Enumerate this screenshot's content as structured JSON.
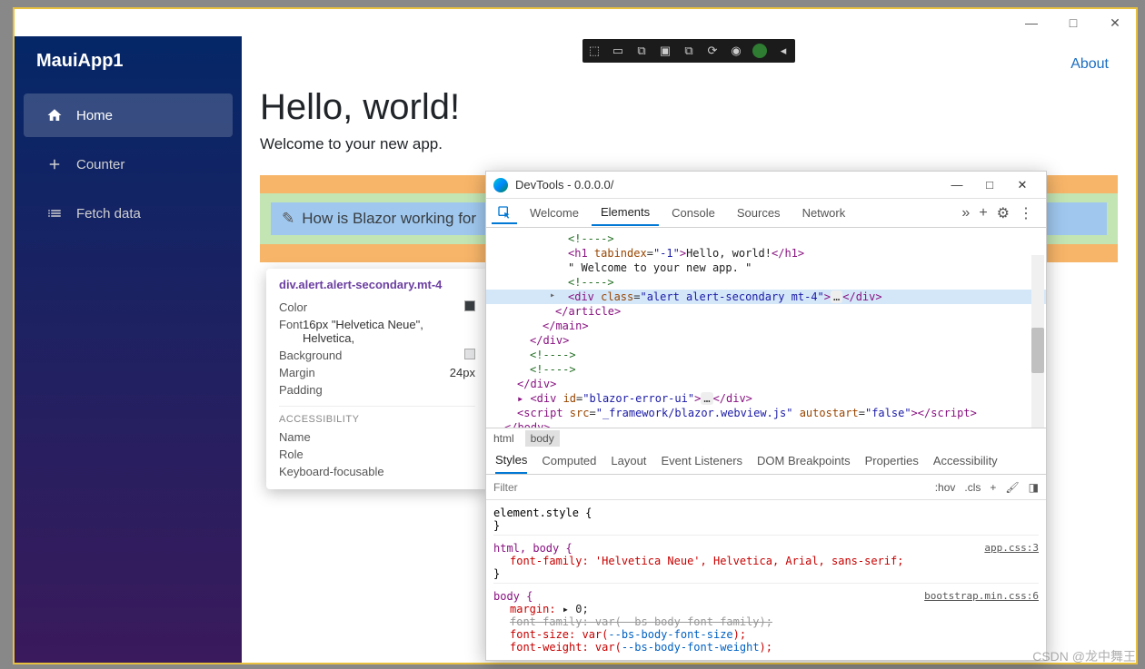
{
  "window": {
    "minimize": "—",
    "maximize": "□",
    "close": "✕"
  },
  "sidebar": {
    "title": "MauiApp1",
    "items": [
      {
        "icon": "home",
        "label": "Home",
        "active": true
      },
      {
        "icon": "plus",
        "label": "Counter",
        "active": false
      },
      {
        "icon": "list",
        "label": "Fetch data",
        "active": false
      }
    ]
  },
  "header": {
    "about": "About"
  },
  "hero": {
    "title": "Hello, world!",
    "subtitle": "Welcome to your new app."
  },
  "highlight": {
    "text": "How is Blazor working for"
  },
  "tooltip": {
    "selector": "div.alert.alert-secondary.mt-4",
    "rows": {
      "color_label": "Color",
      "font_label": "Font",
      "font_value": "16px \"Helvetica Neue\", Helvetica, ",
      "bg_label": "Background",
      "margin_label": "Margin",
      "margin_value": "24px",
      "padding_label": "Padding"
    },
    "a11y_title": "ACCESSIBILITY",
    "a11y": {
      "name": "Name",
      "role": "Role",
      "kbf": "Keyboard-focusable"
    }
  },
  "devtools": {
    "title": "DevTools - 0.0.0.0/",
    "win": {
      "min": "—",
      "max": "□",
      "close": "✕"
    },
    "tabs": {
      "welcome": "Welcome",
      "elements": "Elements",
      "console": "Console",
      "sources": "Sources",
      "network": "Network",
      "more": "»",
      "plus": "+"
    },
    "dom": {
      "l1": "<!---->",
      "l2_open": "<h1 ",
      "l2_attr": "tabindex",
      "l2_val": "\"-1\"",
      "l2_text": "Hello, world!",
      "l2_close": "</h1>",
      "l3": "\" Welcome to your new app. \"",
      "l4": "<!---->",
      "l5_open": "<div ",
      "l5_attr": "class",
      "l5_val": "\"alert alert-secondary mt-4\"",
      "l5_ell": "…",
      "l5_close": "</div>",
      "l6": "</article>",
      "l7": "</main>",
      "l8": "</div>",
      "l9": "<!---->",
      "l10": "<!---->",
      "l11": "</div>",
      "l12_open": "▸ <div ",
      "l12_attr": "id",
      "l12_val": "\"blazor-error-ui\"",
      "l12_ell": "…",
      "l12_close": "</div>",
      "l13_open": "<script ",
      "l13_a1": "src",
      "l13_v1": "\"_framework/blazor.webview.js\"",
      "l13_a2": "autostart",
      "l13_v2": "\"false\"",
      "l13_close_tag": ">",
      "l13_endtag": "<",
      "l13_endtag2": "/script>",
      "l14": "</body>"
    },
    "crumbs": {
      "html": "html",
      "body": "body"
    },
    "styles_tabs": {
      "styles": "Styles",
      "computed": "Computed",
      "layout": "Layout",
      "listeners": "Event Listeners",
      "breakpoints": "DOM Breakpoints",
      "properties": "Properties",
      "accessibility": "Accessibility"
    },
    "filter": {
      "placeholder": "Filter",
      "hov": ":hov",
      "cls": ".cls",
      "plus": "+"
    },
    "rules": {
      "r1_sel": "element.style {",
      "r1_close": "}",
      "r2_sel": "html, body {",
      "r2_link": "app.css:3",
      "r2_p1": "font-family: 'Helvetica Neue', Helvetica, Arial, sans-serif;",
      "r2_close": "}",
      "r3_sel": "body {",
      "r3_link": "bootstrap.min.css:6",
      "r3_p1_label": "margin:",
      "r3_p1_val": " ▸ 0;",
      "r3_p2_strike": "font-family: var(--bs-body-font-family);",
      "r3_p3_label": "font-size: var(",
      "r3_p3_var": "--bs-body-font-size",
      "r3_p3_end": ");",
      "r3_p4_label": "font-weight: var(",
      "r3_p4_var": "--bs-body-font-weight",
      "r3_p4_end": ");"
    }
  },
  "watermark": "CSDN @龙中舞王"
}
